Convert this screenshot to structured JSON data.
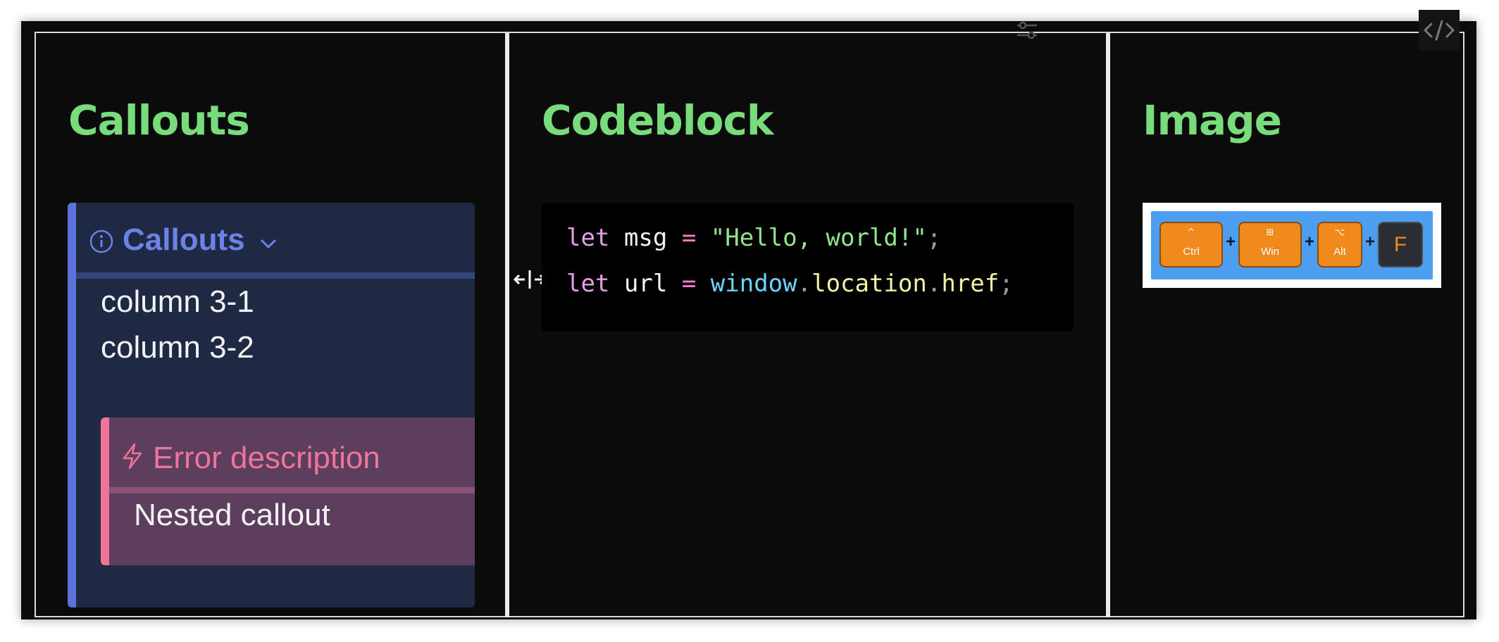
{
  "columns": [
    {
      "title": "Callouts"
    },
    {
      "title": "Codeblock"
    },
    {
      "title": "Image"
    }
  ],
  "callout": {
    "icon": "info-icon",
    "title": "Callouts",
    "toggle_icon": "chevron-down-icon",
    "lines": [
      "column 3-1",
      "column 3-2"
    ],
    "nested": {
      "icon": "bolt-icon",
      "title": "Error description",
      "body": "Nested callout"
    }
  },
  "codeblock": {
    "lines": [
      "let msg = \"Hello, world!\";",
      "let url = window.location.href;"
    ],
    "tokens": {
      "let": "let",
      "msg": "msg",
      "eq": "=",
      "hello": "\"Hello, world!\"",
      "semi": ";",
      "url": "url",
      "window": "window",
      "dot": ".",
      "location": "location",
      "href": "href"
    }
  },
  "image": {
    "keys": [
      {
        "symbol": "^",
        "label": "Ctrl"
      },
      {
        "symbol": "⊞",
        "label": "Win"
      },
      {
        "symbol": "⌥",
        "label": "Alt"
      },
      {
        "symbol": "",
        "label": "F"
      }
    ],
    "separator": "+"
  },
  "toolbar": {
    "icons": [
      "filters-icon",
      "code-icon"
    ]
  },
  "colors": {
    "heading": "#79dc7c",
    "callout_accent": "#5c73d9",
    "error_accent": "#f07399",
    "background": "#0b0b0b"
  }
}
